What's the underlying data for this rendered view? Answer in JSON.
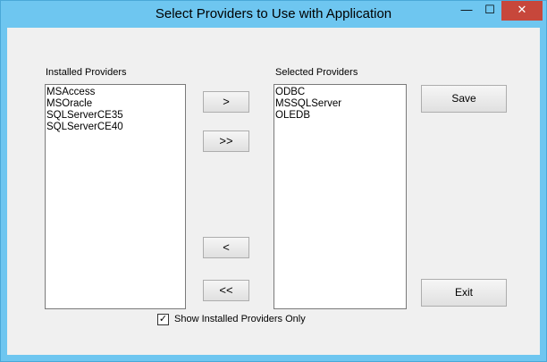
{
  "window": {
    "title": "Select Providers to Use with Application",
    "minimize_glyph": "—",
    "maximize_glyph": "☐",
    "close_glyph": "✕"
  },
  "installed": {
    "label": "Installed Providers",
    "items": [
      "MSAccess",
      "MSOracle",
      "SQLServerCE35",
      "SQLServerCE40"
    ]
  },
  "selected": {
    "label": "Selected Providers",
    "items": [
      "ODBC",
      "MSSQLServer",
      "OLEDB"
    ]
  },
  "buttons": {
    "add_one": ">",
    "add_all": ">>",
    "remove_one": "<",
    "remove_all": "<<",
    "save": "Save",
    "exit": "Exit"
  },
  "show_installed_only": {
    "label": "Show Installed Providers Only",
    "checked": true,
    "check_glyph": "✓"
  }
}
